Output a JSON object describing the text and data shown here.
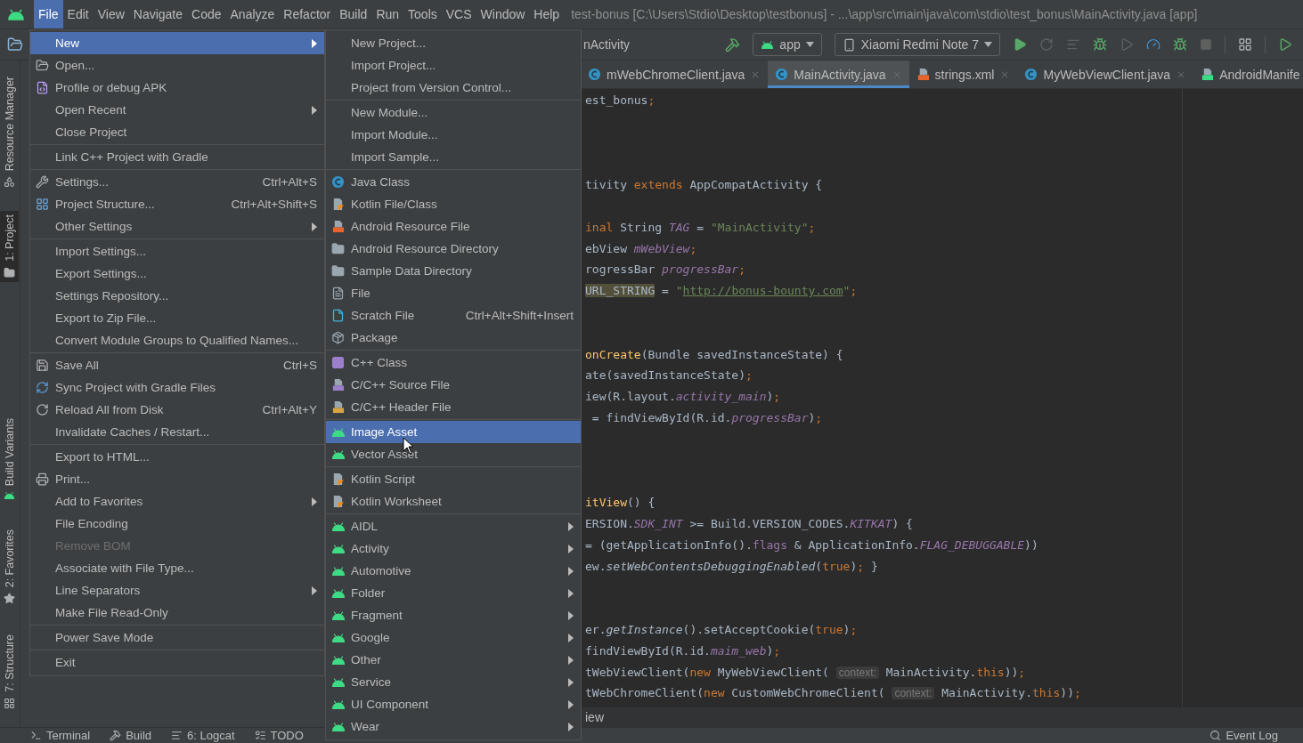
{
  "menu_bar": {
    "items": [
      {
        "label": "File",
        "selected": true
      },
      {
        "label": "Edit",
        "selected": false
      },
      {
        "label": "View",
        "selected": false
      },
      {
        "label": "Navigate",
        "selected": false
      },
      {
        "label": "Code",
        "selected": false
      },
      {
        "label": "Analyze",
        "selected": false
      },
      {
        "label": "Refactor",
        "selected": false
      },
      {
        "label": "Build",
        "selected": false
      },
      {
        "label": "Run",
        "selected": false
      },
      {
        "label": "Tools",
        "selected": false
      },
      {
        "label": "VCS",
        "selected": false
      },
      {
        "label": "Window",
        "selected": false
      },
      {
        "label": "Help",
        "selected": false
      }
    ],
    "title": "test-bonus [C:\\Users\\Stdio\\Desktop\\testbonus] - ...\\app\\src\\main\\java\\com\\stdio\\test_bonus\\MainActivity.java [app]"
  },
  "toolbar": {
    "breadcrumb": "nActivity",
    "run_config": "app",
    "device": "Xiaomi Redmi Note 7"
  },
  "tool_windows_left": [
    {
      "label": "Resource Manager",
      "kind": "resources",
      "selected": false
    },
    {
      "label": "1: Project",
      "kind": "project",
      "selected": true
    },
    {
      "label": "Build Variants",
      "kind": "variants",
      "selected": false
    },
    {
      "label": "2: Favorites",
      "kind": "favorites",
      "selected": false
    },
    {
      "label": "7: Structure",
      "kind": "structure",
      "selected": false
    }
  ],
  "editor_tabs": [
    {
      "label": "mWebChromeClient.java",
      "kind": "java",
      "selected": false,
      "closable": true
    },
    {
      "label": "MainActivity.java",
      "kind": "java",
      "selected": true,
      "closable": true
    },
    {
      "label": "strings.xml",
      "kind": "xml",
      "selected": false,
      "closable": true
    },
    {
      "label": "MyWebViewClient.java",
      "kind": "java",
      "selected": false,
      "closable": true
    },
    {
      "label": "AndroidManife",
      "kind": "manifest",
      "selected": false,
      "closable": false
    }
  ],
  "code_lines": [
    {
      "kind": "code",
      "segments": [
        {
          "kind": "plain",
          "text": "est_bonus"
        },
        {
          "kind": "keyword",
          "text": ";"
        }
      ]
    },
    {
      "kind": "blank"
    },
    {
      "kind": "blank"
    },
    {
      "kind": "blank"
    },
    {
      "kind": "code",
      "segments": [
        {
          "kind": "plain",
          "text": "tivity "
        },
        {
          "kind": "keyword",
          "text": "extends"
        },
        {
          "kind": "plain",
          "text": " AppCompatActivity {"
        }
      ]
    },
    {
      "kind": "blank"
    },
    {
      "kind": "code",
      "segments": [
        {
          "kind": "keyword",
          "text": "inal"
        },
        {
          "kind": "plain",
          "text": " String "
        },
        {
          "kind": "field",
          "text": "TAG"
        },
        {
          "kind": "plain",
          "text": " = "
        },
        {
          "kind": "string",
          "text": "\"MainActivity\""
        },
        {
          "kind": "keyword",
          "text": ";"
        }
      ]
    },
    {
      "kind": "code",
      "segments": [
        {
          "kind": "plain",
          "text": "ebView "
        },
        {
          "kind": "field",
          "text": "mWebView"
        },
        {
          "kind": "keyword",
          "text": ";"
        }
      ]
    },
    {
      "kind": "code",
      "segments": [
        {
          "kind": "plain",
          "text": "rogressBar "
        },
        {
          "kind": "field",
          "text": "progressBar"
        },
        {
          "kind": "keyword",
          "text": ";"
        }
      ]
    },
    {
      "kind": "code",
      "segments": [
        {
          "kind": "warn",
          "text": "URL_STRING"
        },
        {
          "kind": "plain",
          "text": " = "
        },
        {
          "kind": "string",
          "text": "\""
        },
        {
          "kind": "link",
          "text": "http://bonus-bounty.com"
        },
        {
          "kind": "string",
          "text": "\""
        },
        {
          "kind": "keyword",
          "text": ";"
        }
      ]
    },
    {
      "kind": "blank"
    },
    {
      "kind": "blank"
    },
    {
      "kind": "code",
      "segments": [
        {
          "kind": "method",
          "text": "onCreate"
        },
        {
          "kind": "plain",
          "text": "(Bundle savedInstanceState) {"
        }
      ]
    },
    {
      "kind": "code",
      "segments": [
        {
          "kind": "plain",
          "text": "ate(savedInstanceState)"
        },
        {
          "kind": "keyword",
          "text": ";"
        }
      ]
    },
    {
      "kind": "code",
      "segments": [
        {
          "kind": "plain",
          "text": "iew(R.layout."
        },
        {
          "kind": "field",
          "text": "activity_main"
        },
        {
          "kind": "plain",
          "text": ")"
        },
        {
          "kind": "keyword",
          "text": ";"
        }
      ]
    },
    {
      "kind": "code",
      "segments": [
        {
          "kind": "plain",
          "text": " = findViewById(R.id."
        },
        {
          "kind": "field",
          "text": "progressBar"
        },
        {
          "kind": "plain",
          "text": ")"
        },
        {
          "kind": "keyword",
          "text": ";"
        }
      ]
    },
    {
      "kind": "blank"
    },
    {
      "kind": "blank"
    },
    {
      "kind": "blank"
    },
    {
      "kind": "code",
      "segments": [
        {
          "kind": "method",
          "text": "itView"
        },
        {
          "kind": "plain",
          "text": "() {"
        }
      ]
    },
    {
      "kind": "code",
      "segments": [
        {
          "kind": "plain",
          "text": "ERSION."
        },
        {
          "kind": "field",
          "text": "SDK_INT"
        },
        {
          "kind": "plain",
          "text": " >= Build.VERSION_CODES."
        },
        {
          "kind": "field",
          "text": "KITKAT"
        },
        {
          "kind": "plain",
          "text": ") {"
        }
      ]
    },
    {
      "kind": "code",
      "segments": [
        {
          "kind": "plain",
          "text": "= (getApplicationInfo()."
        },
        {
          "kind": "member",
          "text": "flags"
        },
        {
          "kind": "plain",
          "text": " & ApplicationInfo."
        },
        {
          "kind": "field",
          "text": "FLAG_DEBUGGABLE"
        },
        {
          "kind": "plain",
          "text": "))"
        }
      ]
    },
    {
      "kind": "code",
      "segments": [
        {
          "kind": "plain",
          "text": "ew."
        },
        {
          "kind": "italic",
          "text": "setWebContentsDebuggingEnabled"
        },
        {
          "kind": "plain",
          "text": "("
        },
        {
          "kind": "keyword",
          "text": "true"
        },
        {
          "kind": "plain",
          "text": ")"
        },
        {
          "kind": "keyword",
          "text": ";"
        },
        {
          "kind": "plain",
          "text": " }"
        }
      ]
    },
    {
      "kind": "blank"
    },
    {
      "kind": "blank"
    },
    {
      "kind": "code",
      "segments": [
        {
          "kind": "plain",
          "text": "er."
        },
        {
          "kind": "italic",
          "text": "getInstance"
        },
        {
          "kind": "plain",
          "text": "().setAcceptCookie("
        },
        {
          "kind": "keyword",
          "text": "true"
        },
        {
          "kind": "plain",
          "text": ")"
        },
        {
          "kind": "keyword",
          "text": ";"
        }
      ]
    },
    {
      "kind": "code",
      "segments": [
        {
          "kind": "plain",
          "text": "findViewById(R.id."
        },
        {
          "kind": "field",
          "text": "maim_web"
        },
        {
          "kind": "plain",
          "text": ")"
        },
        {
          "kind": "keyword",
          "text": ";"
        }
      ]
    },
    {
      "kind": "code",
      "segments": [
        {
          "kind": "plain",
          "text": "tWebViewClient("
        },
        {
          "kind": "keyword",
          "text": "new"
        },
        {
          "kind": "plain",
          "text": " MyWebViewClient( "
        },
        {
          "kind": "hint",
          "text": "context:"
        },
        {
          "kind": "plain",
          "text": " MainActivity."
        },
        {
          "kind": "keyword",
          "text": "this"
        },
        {
          "kind": "plain",
          "text": "))"
        },
        {
          "kind": "keyword",
          "text": ";"
        }
      ]
    },
    {
      "kind": "code",
      "segments": [
        {
          "kind": "plain",
          "text": "tWebChromeClient("
        },
        {
          "kind": "keyword",
          "text": "new"
        },
        {
          "kind": "plain",
          "text": " CustomWebChromeClient( "
        },
        {
          "kind": "hint",
          "text": "context:"
        },
        {
          "kind": "plain",
          "text": " MainActivity."
        },
        {
          "kind": "keyword",
          "text": "this"
        },
        {
          "kind": "plain",
          "text": "))"
        },
        {
          "kind": "keyword",
          "text": ";"
        }
      ]
    }
  ],
  "breadcrumb": "iew",
  "bottom_tools": [
    {
      "label": "Terminal",
      "kind": "terminal"
    },
    {
      "label": "Build",
      "kind": "build"
    },
    {
      "label": "6: Logcat",
      "kind": "logcat"
    },
    {
      "label": "TODO",
      "kind": "todo"
    }
  ],
  "event_log": "Event Log",
  "file_menu": {
    "groups": [
      [
        {
          "label": "New",
          "kind": "plain",
          "selected": true,
          "submenu": true,
          "disabled": false
        },
        {
          "label": "Open...",
          "kind": "open",
          "selected": false,
          "submenu": false,
          "disabled": false
        },
        {
          "label": "Profile or debug APK",
          "kind": "apk",
          "selected": false,
          "submenu": false,
          "disabled": false
        },
        {
          "label": "Open Recent",
          "kind": "plain",
          "selected": false,
          "submenu": true,
          "disabled": false
        },
        {
          "label": "Close Project",
          "kind": "plain",
          "selected": false,
          "submenu": false,
          "disabled": false
        }
      ],
      [
        {
          "label": "Link C++ Project with Gradle",
          "kind": "plain",
          "selected": false,
          "submenu": false,
          "disabled": false
        }
      ],
      [
        {
          "label": "Settings...",
          "kind": "settings",
          "shortcut": "Ctrl+Alt+S",
          "selected": false,
          "submenu": false,
          "disabled": false
        },
        {
          "label": "Project Structure...",
          "kind": "structure",
          "shortcut": "Ctrl+Alt+Shift+S",
          "selected": false,
          "submenu": false,
          "disabled": false
        },
        {
          "label": "Other Settings",
          "kind": "plain",
          "selected": false,
          "submenu": true,
          "disabled": false
        }
      ],
      [
        {
          "label": "Import Settings...",
          "kind": "plain",
          "selected": false,
          "submenu": false,
          "disabled": false
        },
        {
          "label": "Export Settings...",
          "kind": "plain",
          "selected": false,
          "submenu": false,
          "disabled": false
        },
        {
          "label": "Settings Repository...",
          "kind": "plain",
          "selected": false,
          "submenu": false,
          "disabled": false
        },
        {
          "label": "Export to Zip File...",
          "kind": "plain",
          "selected": false,
          "submenu": false,
          "disabled": false
        },
        {
          "label": "Convert Module Groups to Qualified Names...",
          "kind": "plain",
          "selected": false,
          "submenu": false,
          "disabled": false
        }
      ],
      [
        {
          "label": "Save All",
          "kind": "save",
          "shortcut": "Ctrl+S",
          "selected": false,
          "submenu": false,
          "disabled": false
        },
        {
          "label": "Sync Project with Gradle Files",
          "kind": "sync",
          "selected": false,
          "submenu": false,
          "disabled": false
        },
        {
          "label": "Reload All from Disk",
          "kind": "reload",
          "shortcut": "Ctrl+Alt+Y",
          "selected": false,
          "submenu": false,
          "disabled": false
        },
        {
          "label": "Invalidate Caches / Restart...",
          "kind": "plain",
          "selected": false,
          "submenu": false,
          "disabled": false
        }
      ],
      [
        {
          "label": "Export to HTML...",
          "kind": "plain",
          "selected": false,
          "submenu": false,
          "disabled": false
        },
        {
          "label": "Print...",
          "kind": "print",
          "selected": false,
          "submenu": false,
          "disabled": false
        },
        {
          "label": "Add to Favorites",
          "kind": "plain",
          "selected": false,
          "submenu": true,
          "disabled": false
        },
        {
          "label": "File Encoding",
          "kind": "plain",
          "selected": false,
          "submenu": false,
          "disabled": false
        },
        {
          "label": "Remove BOM",
          "kind": "plain",
          "selected": false,
          "submenu": false,
          "disabled": true
        },
        {
          "label": "Associate with File Type...",
          "kind": "plain",
          "selected": false,
          "submenu": false,
          "disabled": false
        },
        {
          "label": "Line Separators",
          "kind": "plain",
          "selected": false,
          "submenu": true,
          "disabled": false
        },
        {
          "label": "Make File Read-Only",
          "kind": "plain",
          "selected": false,
          "submenu": false,
          "disabled": false
        }
      ],
      [
        {
          "label": "Power Save Mode",
          "kind": "plain",
          "selected": false,
          "submenu": false,
          "disabled": false
        }
      ],
      [
        {
          "label": "Exit",
          "kind": "plain",
          "selected": false,
          "submenu": false,
          "disabled": false
        }
      ]
    ]
  },
  "new_submenu": {
    "groups": [
      [
        {
          "label": "New Project...",
          "kind": "plain",
          "selected": false,
          "submenu": false
        },
        {
          "label": "Import Project...",
          "kind": "plain",
          "selected": false,
          "submenu": false
        },
        {
          "label": "Project from Version Control...",
          "kind": "plain",
          "selected": false,
          "submenu": false
        }
      ],
      [
        {
          "label": "New Module...",
          "kind": "plain",
          "selected": false,
          "submenu": false
        },
        {
          "label": "Import Module...",
          "kind": "plain",
          "selected": false,
          "submenu": false
        },
        {
          "label": "Import Sample...",
          "kind": "plain",
          "selected": false,
          "submenu": false
        }
      ],
      [
        {
          "label": "Java Class",
          "kind": "java",
          "selected": false,
          "submenu": false
        },
        {
          "label": "Kotlin File/Class",
          "kind": "kotlin",
          "selected": false,
          "submenu": false
        },
        {
          "label": "Android Resource File",
          "kind": "xml",
          "selected": false,
          "submenu": false
        },
        {
          "label": "Android Resource Directory",
          "kind": "directory",
          "selected": false,
          "submenu": false
        },
        {
          "label": "Sample Data Directory",
          "kind": "directory",
          "selected": false,
          "submenu": false
        },
        {
          "label": "File",
          "kind": "file",
          "selected": false,
          "submenu": false
        },
        {
          "label": "Scratch File",
          "kind": "scratch",
          "shortcut": "Ctrl+Alt+Shift+Insert",
          "selected": false,
          "submenu": false
        },
        {
          "label": "Package",
          "kind": "package",
          "selected": false,
          "submenu": false
        }
      ],
      [
        {
          "label": "C++ Class",
          "kind": "cpp-class",
          "selected": false,
          "submenu": false
        },
        {
          "label": "C/C++ Source File",
          "kind": "cpp-source",
          "selected": false,
          "submenu": false
        },
        {
          "label": "C/C++ Header File",
          "kind": "cpp-header",
          "selected": false,
          "submenu": false
        }
      ],
      [
        {
          "label": "Image Asset",
          "kind": "android",
          "selected": true,
          "submenu": false
        },
        {
          "label": "Vector Asset",
          "kind": "android",
          "selected": false,
          "submenu": false
        }
      ],
      [
        {
          "label": "Kotlin Script",
          "kind": "kotlin",
          "selected": false,
          "submenu": false
        },
        {
          "label": "Kotlin Worksheet",
          "kind": "kotlin",
          "selected": false,
          "submenu": false
        }
      ],
      [
        {
          "label": "AIDL",
          "kind": "android",
          "selected": false,
          "submenu": true
        },
        {
          "label": "Activity",
          "kind": "android",
          "selected": false,
          "submenu": true
        },
        {
          "label": "Automotive",
          "kind": "android",
          "selected": false,
          "submenu": true
        },
        {
          "label": "Folder",
          "kind": "android",
          "selected": false,
          "submenu": true
        },
        {
          "label": "Fragment",
          "kind": "android",
          "selected": false,
          "submenu": true
        },
        {
          "label": "Google",
          "kind": "android",
          "selected": false,
          "submenu": true
        },
        {
          "label": "Other",
          "kind": "android",
          "selected": false,
          "submenu": true
        },
        {
          "label": "Service",
          "kind": "android",
          "selected": false,
          "submenu": true
        },
        {
          "label": "UI Component",
          "kind": "android",
          "selected": false,
          "submenu": true
        },
        {
          "label": "Wear",
          "kind": "android",
          "selected": false,
          "submenu": true
        }
      ]
    ]
  }
}
